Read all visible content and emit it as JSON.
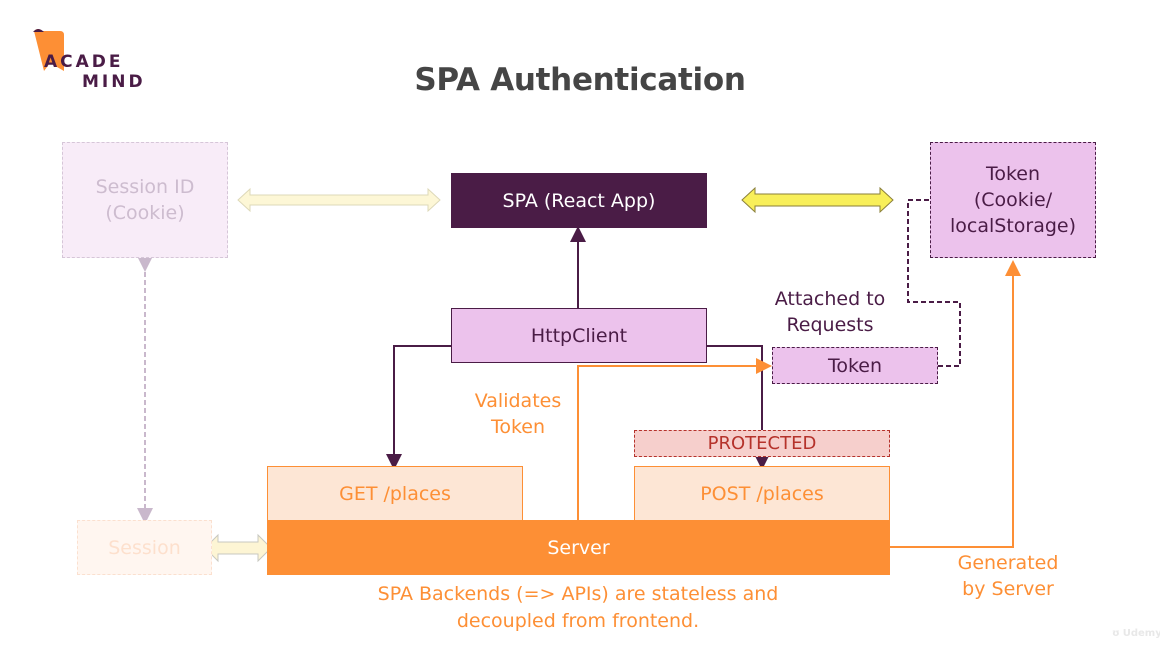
{
  "logo": {
    "line1": "ACADE",
    "line2": "MIND"
  },
  "title": "SPA Authentication",
  "nodes": {
    "session_id": "Session ID (Cookie)",
    "spa": "SPA (React App)",
    "token_store_line1": "Token",
    "token_store_line2": "(Cookie/",
    "token_store_line3": "localStorage)",
    "http_client": "HttpClient",
    "token": "Token",
    "protected": "PROTECTED",
    "get_places": "GET /places",
    "post_places": "POST /places",
    "server": "Server",
    "session": "Session"
  },
  "labels": {
    "attached_line1": "Attached to",
    "attached_line2": "Requests",
    "validates_line1": "Validates",
    "validates_line2": "Token",
    "generated_line1": "Generated",
    "generated_line2": "by Server",
    "footer_line1": "SPA Backends (=> APIs) are stateless and",
    "footer_line2": "decoupled from frontend."
  },
  "watermark": "Udemy",
  "colors": {
    "dark_purple": "#4a1c46",
    "light_purple": "#ecc2ec",
    "orange": "#fd8f35",
    "light_orange": "#fde6d5",
    "protected_bg": "#f6cfcc",
    "protected_text": "#b5322b",
    "yellow": "#f8ef5a",
    "title": "#454545"
  }
}
